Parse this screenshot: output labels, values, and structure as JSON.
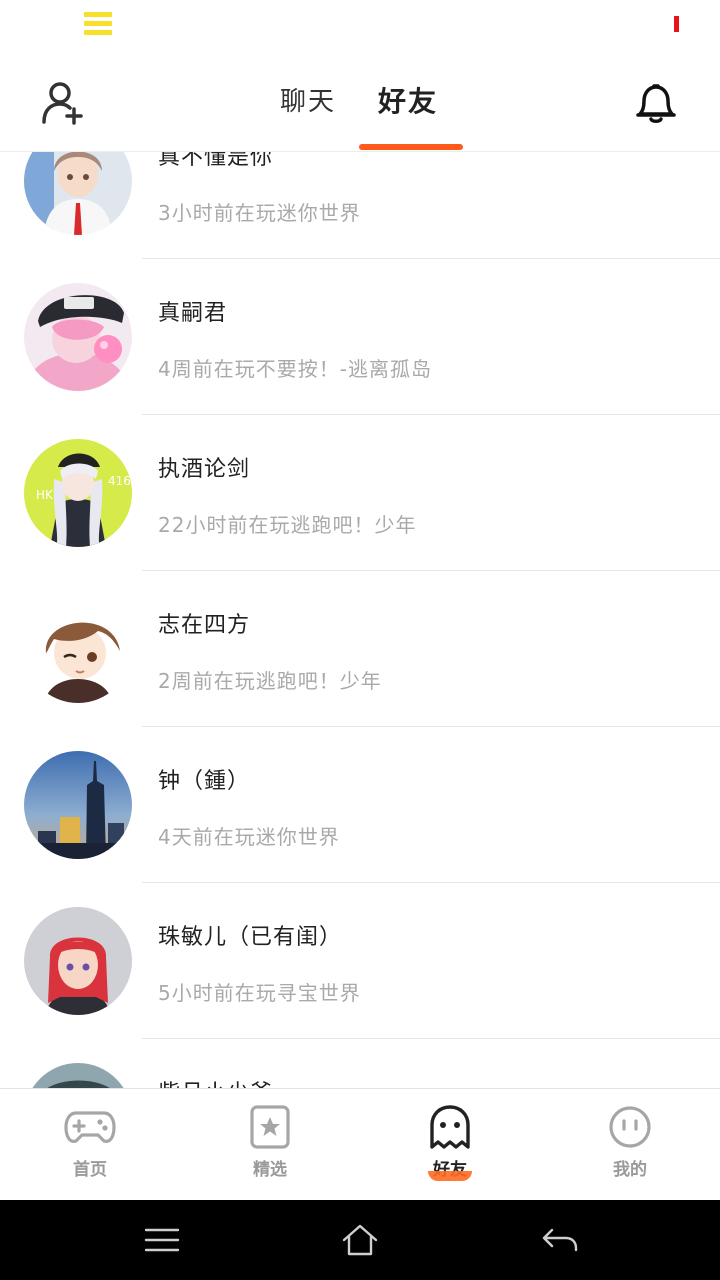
{
  "header": {
    "tabs": [
      {
        "label": "聊天",
        "active": false
      },
      {
        "label": "好友",
        "active": true
      }
    ],
    "accent_color": "#ff5a1c"
  },
  "friends": [
    {
      "name": "真不懂是你",
      "status": "3小时前在玩迷你世界",
      "avatar": "avatar-anime-boy-white-shirt"
    },
    {
      "name": "真嗣君",
      "status": "4周前在玩不要按！-逃离孤岛",
      "avatar": "avatar-pink-hair-bubblegum"
    },
    {
      "name": "执酒论剑",
      "status": "22小时前在玩逃跑吧！少年",
      "avatar": "avatar-anime-girl-hk416"
    },
    {
      "name": "志在四方",
      "status": "2周前在玩逃跑吧！少年",
      "avatar": "avatar-brown-hair-wink"
    },
    {
      "name": "钟（鍾）",
      "status": "4天前在玩迷你世界",
      "avatar": "avatar-city-skyscraper"
    },
    {
      "name": "珠敏儿（已有闺）",
      "status": "5小时前在玩寻宝世界",
      "avatar": "avatar-red-hair-girl"
    },
    {
      "name": "紫月小少爷",
      "status": "",
      "avatar": "avatar-partial"
    }
  ],
  "bottom_nav": [
    {
      "label": "首页",
      "icon": "gamepad-icon",
      "active": false
    },
    {
      "label": "精选",
      "icon": "star-card-icon",
      "active": false
    },
    {
      "label": "好友",
      "icon": "ghost-icon",
      "active": true
    },
    {
      "label": "我的",
      "icon": "face-icon",
      "active": false
    }
  ],
  "system_nav": [
    "menu-icon",
    "home-icon",
    "back-icon"
  ]
}
